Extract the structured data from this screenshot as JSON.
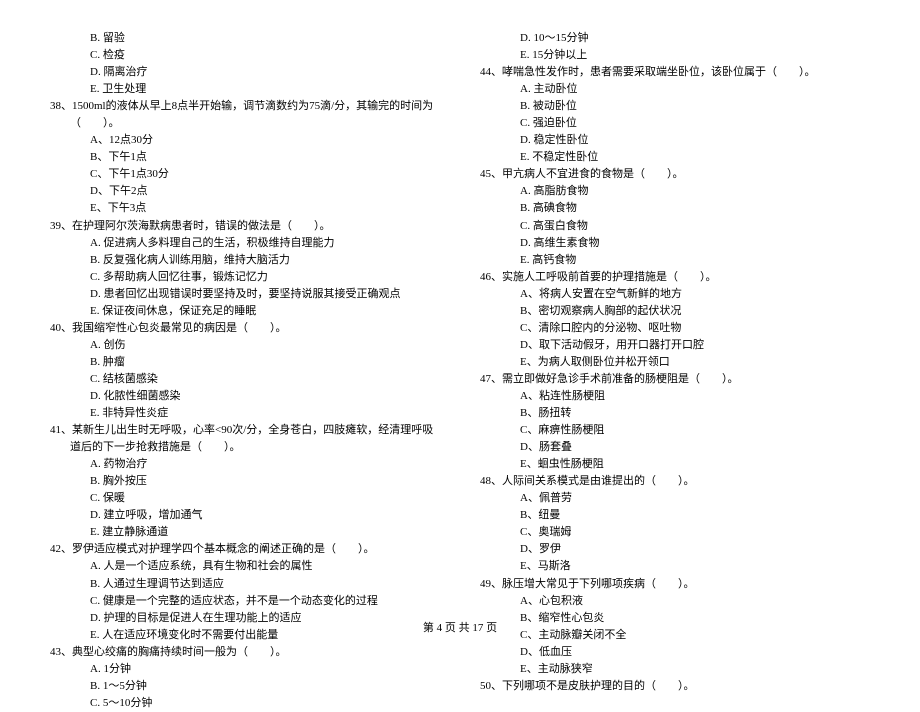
{
  "left_column": {
    "q37_options": [
      "B. 留验",
      "C. 检疫",
      "D. 隔离治疗",
      "E. 卫生处理"
    ],
    "q38": "38、1500ml的液体从早上8点半开始输，调节滴数约为75滴/分，其输完的时间为（　　）。",
    "q38_options": [
      "A、12点30分",
      "B、下午1点",
      "C、下午1点30分",
      "D、下午2点",
      "E、下午3点"
    ],
    "q39": "39、在护理阿尔茨海默病患者时，错误的做法是（　　）。",
    "q39_options": [
      "A. 促进病人多料理自己的生活，积极维持自理能力",
      "B. 反复强化病人训练用脑，维持大脑活力",
      "C. 多帮助病人回忆往事，锻炼记忆力",
      "D. 患者回忆出现错误时要坚持及时，要坚持说服其接受正确观点",
      "E. 保证夜间休息，保证充足的睡眠"
    ],
    "q40": "40、我国缩窄性心包炎最常见的病因是（　　）。",
    "q40_options": [
      "A. 创伤",
      "B. 肿瘤",
      "C. 结核菌感染",
      "D. 化脓性细菌感染",
      "E. 非特异性炎症"
    ],
    "q41": "41、某新生儿出生时无呼吸，心率<90次/分，全身苍白，四肢瘫软，经清理呼吸道后的下一步抢救措施是（　　）。",
    "q41_options": [
      "A. 药物治疗",
      "B. 胸外按压",
      "C. 保暖",
      "D. 建立呼吸，增加通气",
      "E. 建立静脉通道"
    ],
    "q42": "42、罗伊适应模式对护理学四个基本概念的阐述正确的是（　　）。",
    "q42_options": [
      "A. 人是一个适应系统，具有生物和社会的属性",
      "B. 人通过生理调节达到适应",
      "C. 健康是一个完整的适应状态，并不是一个动态变化的过程",
      "D. 护理的目标是促进人在生理功能上的适应",
      "E. 人在适应环境变化时不需要付出能量"
    ],
    "q43": "43、典型心绞痛的胸痛持续时间一般为（　　）。",
    "q43_options": [
      "A. 1分钟",
      "B. 1～5分钟",
      "C. 5～10分钟"
    ]
  },
  "right_column": {
    "q43_options_cont": [
      "D. 10～15分钟",
      "E. 15分钟以上"
    ],
    "q44": "44、哮喘急性发作时，患者需要采取端坐卧位，该卧位属于（　　）。",
    "q44_options": [
      "A. 主动卧位",
      "B. 被动卧位",
      "C. 强迫卧位",
      "D. 稳定性卧位",
      "E. 不稳定性卧位"
    ],
    "q45": "45、甲亢病人不宜进食的食物是（　　）。",
    "q45_options": [
      "A. 高脂肪食物",
      "B. 高碘食物",
      "C. 高蛋白食物",
      "D. 高维生素食物",
      "E. 高钙食物"
    ],
    "q46": "46、实施人工呼吸前首要的护理措施是（　　）。",
    "q46_options": [
      "A、将病人安置在空气新鲜的地方",
      "B、密切观察病人胸部的起伏状况",
      "C、清除口腔内的分泌物、呕吐物",
      "D、取下活动假牙，用开口器打开口腔",
      "E、为病人取侧卧位并松开领口"
    ],
    "q47": "47、需立即做好急诊手术前准备的肠梗阻是（　　）。",
    "q47_options": [
      "A、粘连性肠梗阻",
      "B、肠扭转",
      "C、麻痹性肠梗阻",
      "D、肠套叠",
      "E、蛔虫性肠梗阻"
    ],
    "q48": "48、人际间关系模式是由谁提出的（　　）。",
    "q48_options": [
      "A、佩普劳",
      "B、纽曼",
      "C、奥瑞姆",
      "D、罗伊",
      "E、马斯洛"
    ],
    "q49": "49、脉压增大常见于下列哪项疾病（　　）。",
    "q49_options": [
      "A、心包积液",
      "B、缩窄性心包炎",
      "C、主动脉瓣关闭不全",
      "D、低血压",
      "E、主动脉狭窄"
    ],
    "q50": "50、下列哪项不是皮肤护理的目的（　　）。"
  },
  "footer": "第 4 页 共 17 页"
}
